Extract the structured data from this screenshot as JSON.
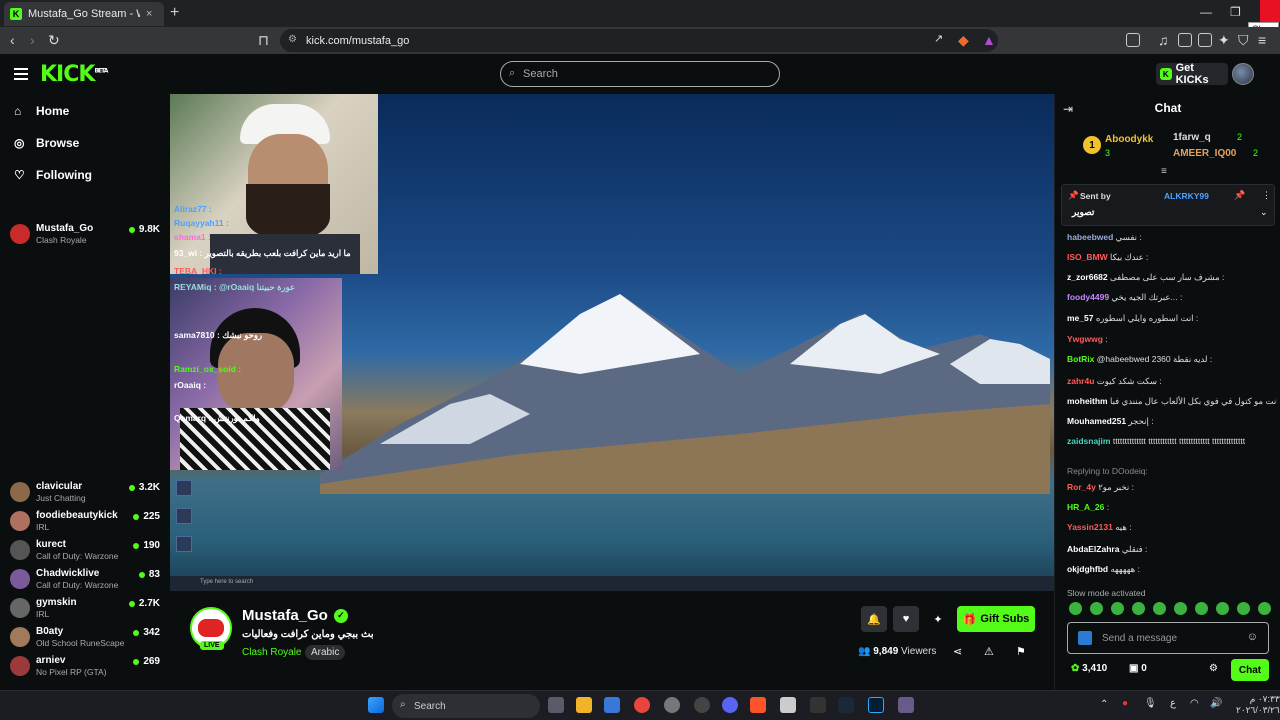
{
  "browser": {
    "tab_title": "Mustafa_Go Stream - Watch Mustafa_Go",
    "tab_close": "×",
    "new_tab": "+",
    "url": "kick.com/mustafa_go",
    "close_tooltip": "Close"
  },
  "header": {
    "logo": "KICK",
    "logo_badge": "BETA",
    "search_placeholder": "Search",
    "get_kicks": "Get KICKs"
  },
  "sidebar": {
    "nav": [
      {
        "label": "Home",
        "icon": "home-icon"
      },
      {
        "label": "Browse",
        "icon": "compass-icon"
      },
      {
        "label": "Following",
        "icon": "heart-icon"
      }
    ],
    "channels": [
      {
        "name": "Mustafa_Go",
        "category": "Clash Royale",
        "viewers": "9.8K",
        "color": "#c92a2a"
      },
      {
        "name": "clavicular",
        "category": "Just Chatting",
        "viewers": "3.2K",
        "color": "#8a6a4a"
      },
      {
        "name": "foodiebeautykick",
        "category": "IRL",
        "viewers": "225",
        "color": "#b07060"
      },
      {
        "name": "kurect",
        "category": "Call of Duty: Warzone",
        "viewers": "190",
        "color": "#555"
      },
      {
        "name": "Chadwicklive",
        "category": "Call of Duty: Warzone",
        "viewers": "83",
        "color": "#7a5a9a"
      },
      {
        "name": "gymskin",
        "category": "IRL",
        "viewers": "2.7K",
        "color": "#666"
      },
      {
        "name": "B0aty",
        "category": "Old School RuneScape",
        "viewers": "342",
        "color": "#a07a5a"
      },
      {
        "name": "arniev",
        "category": "No Pixel RP (GTA)",
        "viewers": "269",
        "color": "#9a3a3a"
      }
    ]
  },
  "overlay_chat": [
    {
      "text": "Aliraz77 :",
      "color": "#4aa3ff"
    },
    {
      "text": "Ruqayyah11 :",
      "color": "#4aa3ff"
    },
    {
      "text": "shama1 :",
      "color": "#ff6ad5"
    },
    {
      "text": "93_wi : ما اريد ماين كرافت بلعب بطريقه بالتصوير",
      "color": "#fff"
    },
    {
      "text": "TEBA_HKI :",
      "color": "#ff5a5a"
    },
    {
      "text": "REYAMiq : @rOaaiq عورة حبيتنا",
      "color": "#9dd"
    },
    {
      "text": "sama7810 : روحو نبشك",
      "color": "#fff"
    },
    {
      "text": "Ramzi_ox_soid :",
      "color": "#53fc18"
    },
    {
      "text": "rOaaiq :",
      "color": "#fff"
    },
    {
      "text": "Qamarq : ولكم تورنتش",
      "color": "#fff"
    }
  ],
  "stream": {
    "streamer": "Mustafa_Go",
    "live": "LIVE",
    "title": "بث ببجي وماين كرافت وفعاليات",
    "category": "Clash Royale",
    "language": "Arabic",
    "viewers": "9,849",
    "viewers_label": "Viewers",
    "gift_subs": "Gift Subs"
  },
  "chat": {
    "title": "Chat",
    "leaderboard": [
      {
        "rank": "1",
        "name": "Aboodykk",
        "count": "3"
      },
      {
        "name": "1farw_q",
        "count": "2"
      },
      {
        "name": "AMEER_IQ00",
        "count": "2"
      }
    ],
    "pinned": {
      "sent_by_label": "Sent by",
      "sender": "ALKRKY99",
      "text": "تصوير"
    },
    "messages": [
      {
        "user": "habeebwed",
        "text": "نفسي :",
        "color": "#9ad"
      },
      {
        "user": "ISO_BMW",
        "text": "عندك بيكا :",
        "color": "#ff5a5a"
      },
      {
        "user": "z_zor6682",
        "text": "مشرف سار سب على مصطفى :",
        "color": "#fff"
      },
      {
        "user": "foody4499",
        "text": "عبرتك الجيه يخي... :",
        "color": "#c48aff"
      },
      {
        "user": "me_57",
        "text": "انت اسطوره وايلي اسطوره :",
        "color": "#fff"
      },
      {
        "user": "Ywgwwg",
        "text": ":",
        "color": "#ff5a5a"
      },
      {
        "user": "BotRix",
        "text": "@habeebwed 2360 لديه نقطة :",
        "color": "#53fc18"
      },
      {
        "user": "zahr4u",
        "text": "سكت شكد كيوت :",
        "color": "#ff5a5a"
      },
      {
        "user": "moheithm",
        "text": "انت مو كتول في فوي بكل الألعاب عال منندي فبا :",
        "color": "#fff"
      },
      {
        "user": "Mouhamed251",
        "text": "إنحجر :",
        "color": "#fff"
      },
      {
        "user": "zaidsnajim",
        "text": "tttttttttttttt tttttttttttt ttttttttttttt tttttttttttttt",
        "color": "#4ad3c0"
      },
      {
        "user": "Ror_4y",
        "text": "نخبر مو٢ :",
        "color": "#ff5a5a"
      },
      {
        "user": "HR_A_26",
        "text": ":",
        "color": "#53fc18"
      },
      {
        "user": "Yassin2131",
        "text": "هيه :",
        "color": "#ff5a5a"
      },
      {
        "user": "AbdaElZahra",
        "text": "فنقلي :",
        "color": "#fff"
      },
      {
        "user": "okjdghfbd",
        "text": "هههههه :",
        "color": "#fff"
      }
    ],
    "reply_to": "Replying to DOodeiq:",
    "slow_mode": "Slow mode activated",
    "input_placeholder": "Send a message",
    "points": "3,410",
    "gifts": "0",
    "send_label": "Chat"
  },
  "taskbar": {
    "search": "Search",
    "time": "٠٧:٣٣ م",
    "date": "٢٠٢٦/٠٣/٢٦",
    "lang": "ع"
  },
  "video_taskbar_search": "Type here to search"
}
